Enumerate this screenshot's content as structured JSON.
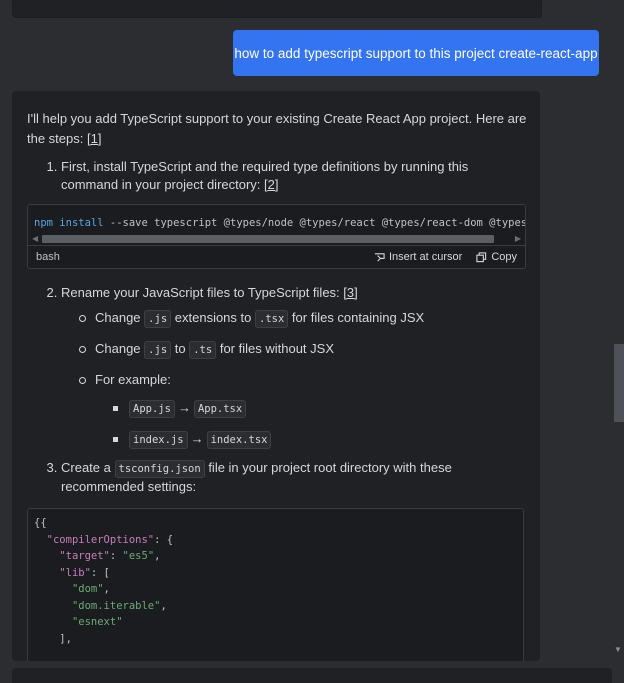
{
  "user_message": "how to add typescript support to this project create-react-app",
  "assistant": {
    "intro": "I'll help you add TypeScript support to your existing Create React App project. Here are the steps:",
    "intro_ref": "[1]",
    "step1": {
      "text": "First, install TypeScript and the required type definitions by running this command in your project directory:",
      "ref": "[2]"
    },
    "code_block": {
      "cmd": "npm",
      "subcmd": "install",
      "args": "--save typescript @types/node @types/react @types/react-dom @types/je",
      "language": "bash",
      "insert_label": "Insert at cursor",
      "copy_label": "Copy"
    },
    "step2": {
      "text": "Rename your JavaScript files to TypeScript files:",
      "ref": "[3]",
      "bullets": [
        {
          "pre": "Change",
          "code1": ".js",
          "mid": "extensions to",
          "code2": ".tsx",
          "post": "for files containing JSX"
        },
        {
          "pre": "Change",
          "code1": ".js",
          "mid": "to",
          "code2": ".ts",
          "post": "for files without JSX"
        }
      ],
      "example_label": "For example:",
      "examples": [
        {
          "from": "App.js",
          "arrow": "→",
          "to": "App.tsx"
        },
        {
          "from": "index.js",
          "arrow": "→",
          "to": "index.tsx"
        }
      ]
    },
    "step3": {
      "pre": "Create a",
      "code": "tsconfig.json",
      "post": "file in your project root directory with these recommended settings:"
    },
    "json_lines": [
      "{{",
      "  \"compilerOptions\": {",
      "    \"target\": \"es5\",",
      "    \"lib\": [",
      "      \"dom\",",
      "      \"dom.iterable\",",
      "      \"esnext\"",
      "    ],"
    ]
  },
  "colors": {
    "accent": "#3574f0",
    "background": "#2b2d30",
    "card": "#202124"
  }
}
